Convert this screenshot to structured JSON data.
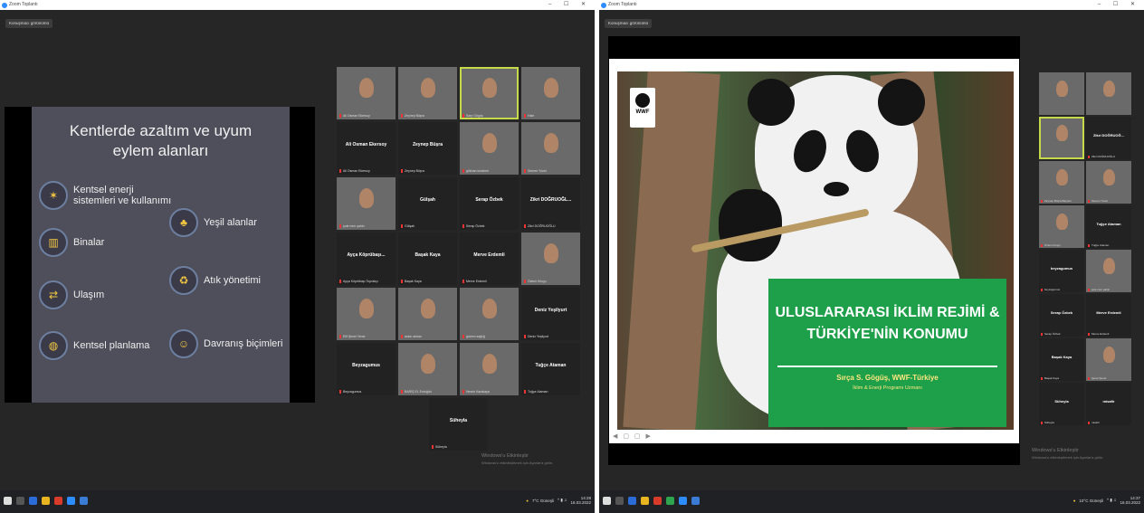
{
  "left_window": {
    "title": "Zoom Toplantı",
    "view_button": "Konuşmacı görünümü",
    "window_controls": "– ☐ ✕",
    "slide": {
      "title": "Kentlerde azaltım ve uyum eylem alanları",
      "items": [
        {
          "label": "Kentsel enerji sistemleri ve kullanımı",
          "icon": "energy-icon"
        },
        {
          "label": "Binalar",
          "icon": "building-icon"
        },
        {
          "label": "Ulaşım",
          "icon": "transport-icon"
        },
        {
          "label": "Kentsel planlama",
          "icon": "globe-icon"
        },
        {
          "label": "Yeşil alanlar",
          "icon": "tree-icon"
        },
        {
          "label": "Atık yönetimi",
          "icon": "recycle-icon"
        },
        {
          "label": "Davranış biçimleri",
          "icon": "person-icon"
        }
      ]
    },
    "gallery": [
      {
        "name": "",
        "label": "Ali Osman Ekersoy",
        "video": true
      },
      {
        "name": "",
        "label": "Zeynep Büşra",
        "video": true
      },
      {
        "name": "",
        "label": "Sarp Gögüş",
        "video": true,
        "active": true
      },
      {
        "name": "",
        "label": "Hale",
        "video": true
      },
      {
        "name": "Ali Osman Ekersoy",
        "label": "Ali Osman Ekersoy",
        "video": false
      },
      {
        "name": "Zeynep Büşra",
        "label": "Zeynep Büşra",
        "video": false
      },
      {
        "name": "",
        "label": "gökhan kındemi",
        "video": true
      },
      {
        "name": "",
        "label": "Semen Yücel",
        "video": true
      },
      {
        "name": "",
        "label": "şule nem şahin",
        "video": true
      },
      {
        "name": "Gülşah",
        "label": "Gülşah",
        "video": false
      },
      {
        "name": "Serap Özbek",
        "label": "Serap Özbek",
        "video": false
      },
      {
        "name": "Zikri DOĞRUOĞL...",
        "label": "Zikri DOĞRUOĞLU",
        "video": false
      },
      {
        "name": "Ayça Köprübaşı...",
        "label": "Ayça Köprübaşı Toprakçı",
        "video": false
      },
      {
        "name": "Başak Kaya",
        "label": "Başak Kaya",
        "video": false
      },
      {
        "name": "Merve Erdemli",
        "label": "Merve Erdemli",
        "video": false
      },
      {
        "name": "",
        "label": "Özlem Kılıççı",
        "video": true
      },
      {
        "name": "",
        "label": "Elif Şenel Yener",
        "video": true
      },
      {
        "name": "",
        "label": "askın akhan",
        "video": true
      },
      {
        "name": "",
        "label": "gözem sağlığ",
        "video": true
      },
      {
        "name": "Deniz Yeşilyurt",
        "label": "Deniz Yeşilyurt",
        "video": false
      },
      {
        "name": "Beyzagumus",
        "label": "Beyzagumus",
        "video": false
      },
      {
        "name": "",
        "label": "BARIŞ EL Erdoğdu",
        "video": true
      },
      {
        "name": "",
        "label": "Nesrin Karakaya",
        "video": true
      },
      {
        "name": "Tuğçe Ataman",
        "label": "Tuğçe Ataman",
        "video": false
      },
      {
        "name": "Süheyla",
        "label": "Süheyla",
        "video": false
      }
    ],
    "watermark": "Windows'u Etkinleştir",
    "watermark_sub": "Windows'u etkinleştirmek için Ayarlar'a gidin.",
    "tray_text": "7°C Güneşli",
    "clock_time": "14:28",
    "clock_date": "16.03.2022"
  },
  "right_window": {
    "title": "Zoom Toplantı",
    "view_button": "Konuşmacı görünümü",
    "window_controls": "– ☐ ✕",
    "slide": {
      "logo": "WWF",
      "title": "ULUSLARARASI İKLİM REJİMİ & TÜRKİYE'NİN KONUMU",
      "presenter": "Sırça S. Gögüş, WWF-Türkiye",
      "role": "İklim & Enerji Programı Uzmanı"
    },
    "gallery": [
      {
        "name": "",
        "label": "",
        "video": true
      },
      {
        "name": "",
        "label": "",
        "video": true
      },
      {
        "name": "",
        "label": "",
        "video": true,
        "active": true
      },
      {
        "name": "Zikri DOĞRUOĞ...",
        "label": "Zikri DOĞRUOĞLU",
        "video": false
      },
      {
        "name": "",
        "label": "Zeynep Büşra Bayram",
        "video": true
      },
      {
        "name": "",
        "label": "Semen Yücel",
        "video": true
      },
      {
        "name": "",
        "label": "Özlem Kılıççı",
        "video": true
      },
      {
        "name": "Tuğçe Ataman",
        "label": "Tuğçe Ataman",
        "video": false
      },
      {
        "name": "beyzagumus",
        "label": "beyzagumus",
        "video": false
      },
      {
        "name": "",
        "label": "şule nem şahin",
        "video": true
      },
      {
        "name": "Serap Özbek",
        "label": "Serap Özbek",
        "video": false
      },
      {
        "name": "Merve Erdemli",
        "label": "Merve Erdemli",
        "video": false
      },
      {
        "name": "Başak Kaya",
        "label": "Başak Kaya",
        "video": false
      },
      {
        "name": "",
        "label": "Şenel Şenel",
        "video": true
      },
      {
        "name": "Süheyla",
        "label": "Süheyla",
        "video": false
      },
      {
        "name": "misafir",
        "label": "misafir",
        "video": false
      }
    ],
    "watermark": "Windows'u Etkinleştir",
    "watermark_sub": "Windows'u etkinleştirmek için Ayarlar'a gidin.",
    "tray_text": "10°C Güneşli",
    "clock_time": "14:37",
    "clock_date": "16.03.2022"
  }
}
